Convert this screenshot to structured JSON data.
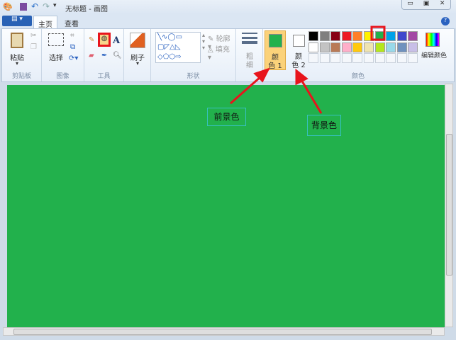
{
  "title": "无标题 - 画图",
  "tabs": [
    {
      "label": "主页"
    },
    {
      "label": "查看"
    }
  ],
  "clipboard": {
    "paste": "粘贴",
    "group": "剪贴板"
  },
  "image": {
    "select": "选择",
    "group": "图像"
  },
  "tools": {
    "group": "工具"
  },
  "brushes": {
    "label": "刷子"
  },
  "shapes": {
    "outline": "轮廓",
    "fill": "填充",
    "group": "形状"
  },
  "size": {
    "label1": "粗",
    "label2": "细"
  },
  "colors": {
    "color1_a": "颜",
    "color1_b": "色 1",
    "color2_a": "颜",
    "color2_b": "色 2",
    "edit": "编辑颜色",
    "group": "颜色",
    "color1": "#22b14c",
    "color2": "#ffffff",
    "row1": [
      "#000000",
      "#7f7f7f",
      "#880015",
      "#ed1c24",
      "#ff7f27",
      "#fff200",
      "#22b14c",
      "#00a2e8",
      "#3f48cc",
      "#a349a4"
    ],
    "row2": [
      "#ffffff",
      "#c3c3c3",
      "#b97a57",
      "#ffaec9",
      "#ffc90e",
      "#efe4b0",
      "#b5e61d",
      "#99d9ea",
      "#7092be",
      "#c8bfe7"
    ]
  },
  "annotations": {
    "foreground": "前景色",
    "background": "背景色",
    "highlight": "#e8141c"
  },
  "canvas_color": "#22b14c"
}
